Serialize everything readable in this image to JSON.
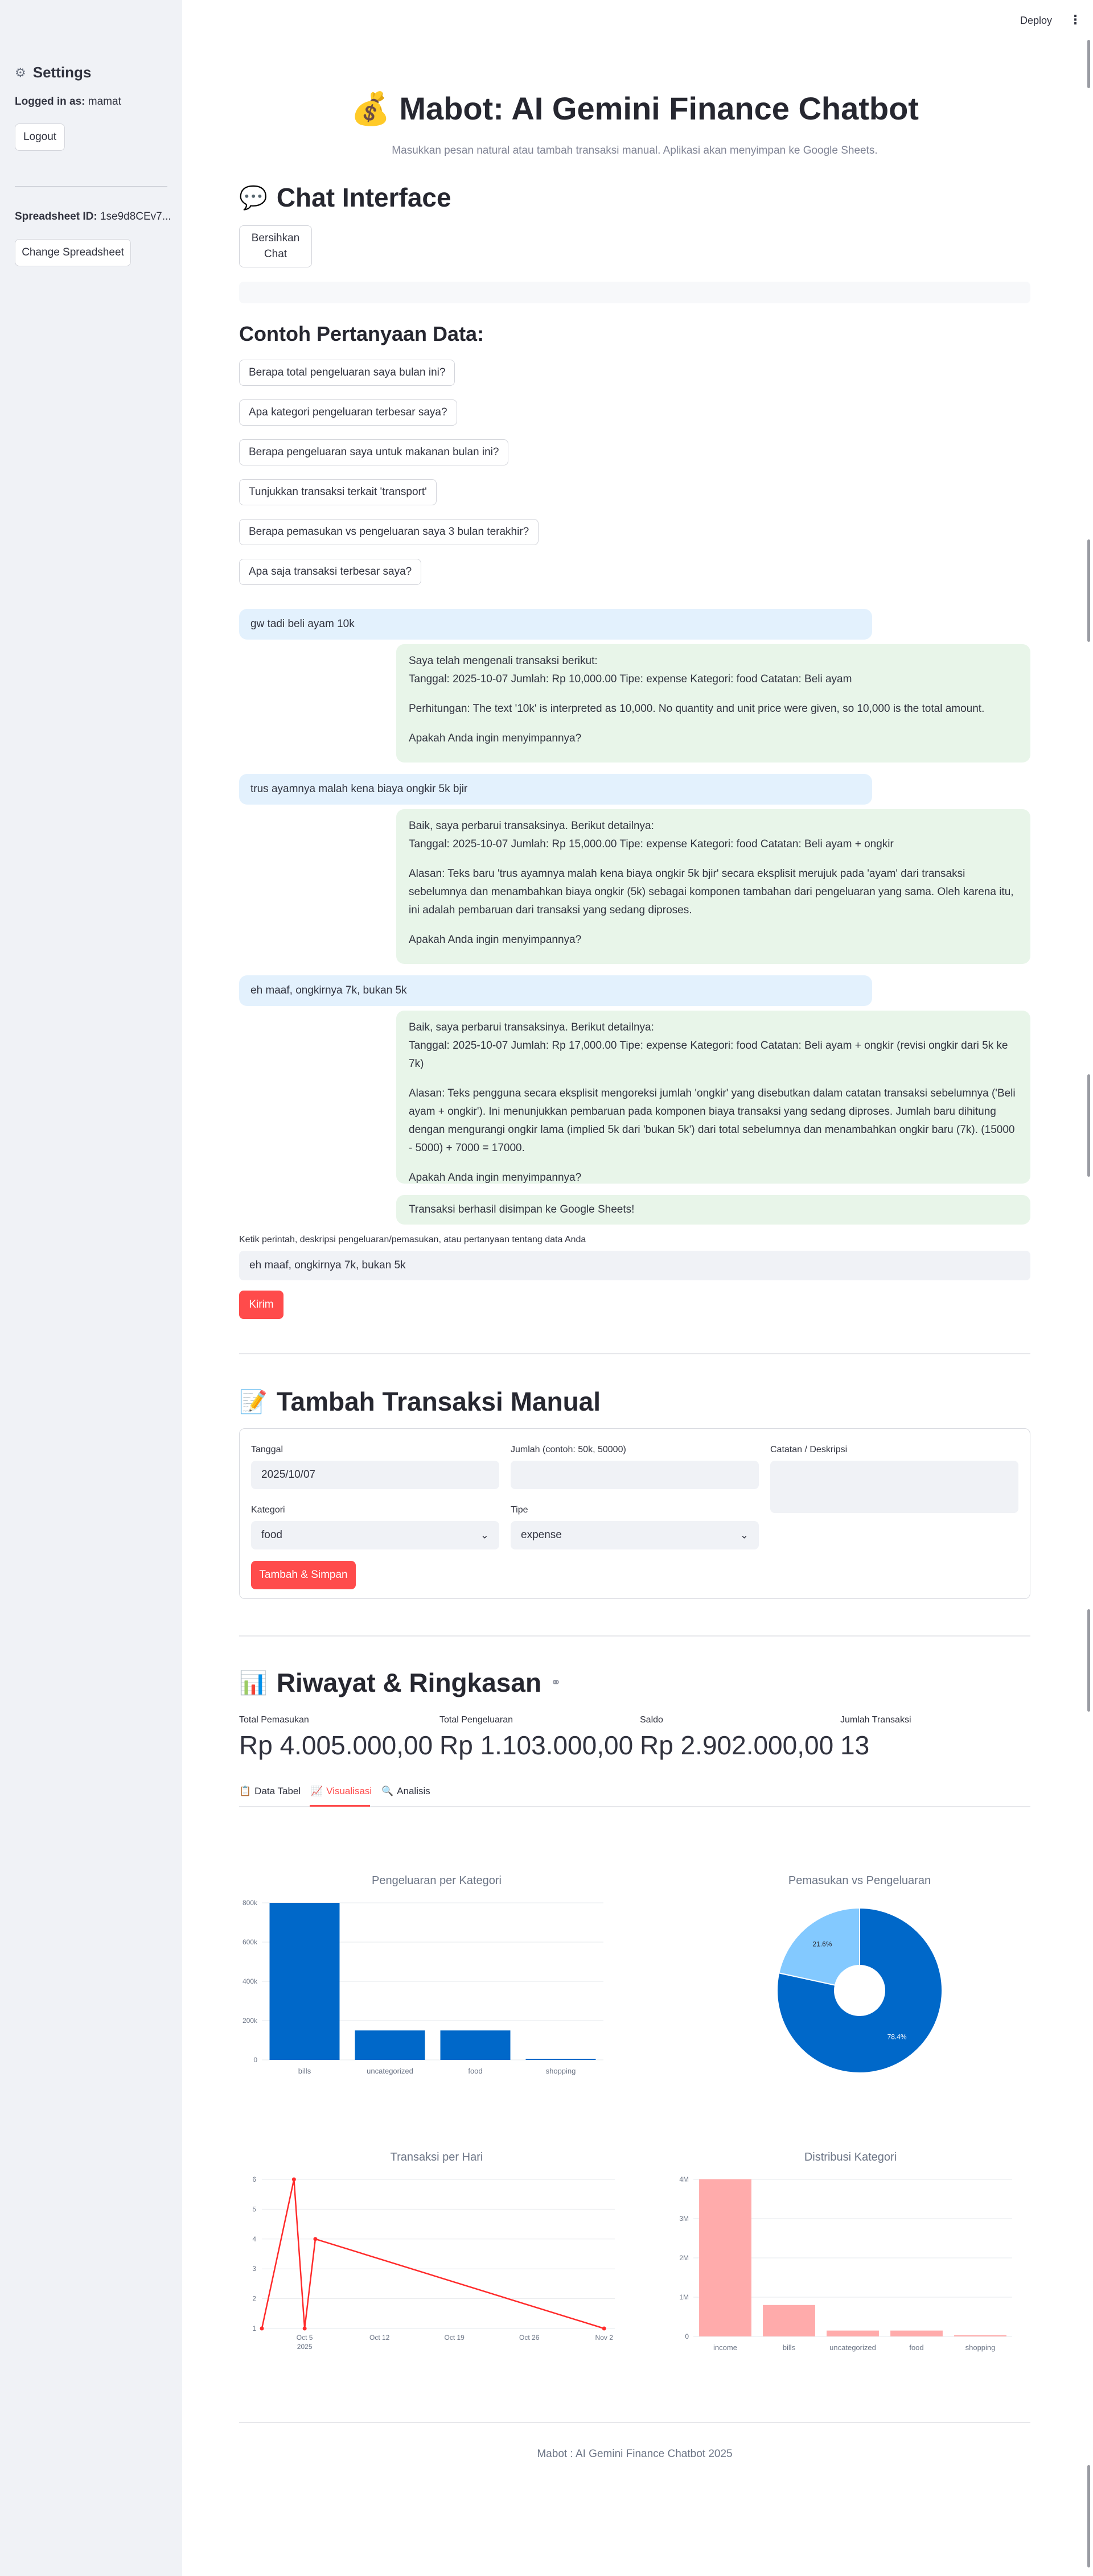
{
  "header": {
    "deploy": "Deploy",
    "menu": "⋮"
  },
  "sidebar": {
    "title": "Settings",
    "logged_in_label": "Logged in as:",
    "logged_in_user": "mamat",
    "logout": "Logout",
    "spreadsheet_label": "Spreadsheet ID:",
    "spreadsheet_id": "1se9d8CEv7...",
    "change_spreadsheet": "Change Spreadsheet"
  },
  "page": {
    "title": "Mabot: AI Gemini Finance Chatbot",
    "title_emoji": "💰",
    "subtitle": "Masukkan pesan natural atau tambah transaksi manual. Aplikasi akan menyimpan ke Google Sheets."
  },
  "chat": {
    "heading": "Chat Interface",
    "heading_emoji": "💬",
    "clear_button": "Bersihkan Chat",
    "examples_heading": "Contoh Pertanyaan Data:",
    "examples": [
      "Berapa total pengeluaran saya bulan ini?",
      "Apa kategori pengeluaran terbesar saya?",
      "Berapa pengeluaran saya untuk makanan bulan ini?",
      "Tunjukkan transaksi terkait 'transport'",
      "Berapa pemasukan vs pengeluaran saya 3 bulan terakhir?",
      "Apa saja transaksi terbesar saya?"
    ],
    "messages": [
      {
        "role": "user",
        "text": "gw tadi beli ayam 10k"
      },
      {
        "role": "bot",
        "lines": [
          "Saya telah mengenali transaksi berikut:\nTanggal: 2025-10-07 Jumlah: Rp 10,000.00 Tipe: expense Kategori: food Catatan: Beli ayam",
          "Perhitungan: The text '10k' is interpreted as 10,000. No quantity and unit price were given, so 10,000 is the total amount.",
          "Apakah Anda ingin menyimpannya?"
        ]
      },
      {
        "role": "user",
        "text": "trus ayamnya malah kena biaya ongkir 5k bjir"
      },
      {
        "role": "bot",
        "lines": [
          "Baik, saya perbarui transaksinya. Berikut detailnya:\nTanggal: 2025-10-07 Jumlah: Rp 15,000.00 Tipe: expense Kategori: food Catatan: Beli ayam + ongkir",
          "Alasan: Teks baru 'trus ayamnya malah kena biaya ongkir 5k bjir' secara eksplisit merujuk pada 'ayam' dari transaksi sebelumnya dan menambahkan biaya ongkir (5k) sebagai komponen tambahan dari pengeluaran yang sama. Oleh karena itu, ini adalah pembaruan dari transaksi yang sedang diproses.",
          "Apakah Anda ingin menyimpannya?"
        ]
      },
      {
        "role": "user",
        "text": "eh maaf, ongkirnya 7k, bukan 5k"
      },
      {
        "role": "bot",
        "lines": [
          "Baik, saya perbarui transaksinya. Berikut detailnya:\nTanggal: 2025-10-07 Jumlah: Rp 17,000.00 Tipe: expense Kategori: food Catatan: Beli ayam + ongkir (revisi ongkir dari 5k ke 7k)",
          "Alasan: Teks pengguna secara eksplisit mengoreksi jumlah 'ongkir' yang disebutkan dalam catatan transaksi sebelumnya ('Beli ayam + ongkir'). Ini menunjukkan pembaruan pada komponen biaya transaksi yang sedang diproses. Jumlah baru dihitung dengan mengurangi ongkir lama (implied 5k dari 'bukan 5k') dari total sebelumnya dan menambahkan ongkir baru (7k). (15000 - 5000) + 7000 = 17000.",
          "Apakah Anda ingin menyimpannya?"
        ]
      },
      {
        "role": "bot",
        "lines": [
          "Transaksi berhasil disimpan ke Google Sheets!"
        ]
      }
    ],
    "input_label": "Ketik perintah, deskripsi pengeluaran/pemasukan, atau pertanyaan tentang data Anda",
    "input_value": "eh maaf, ongkirnya 7k, bukan 5k",
    "send_button": "Kirim"
  },
  "manual": {
    "heading": "Tambah Transaksi Manual",
    "heading_emoji": "📝",
    "date_label": "Tanggal",
    "date_value": "2025/10/07",
    "amount_label": "Jumlah (contoh: 50k, 50000)",
    "amount_value": "",
    "note_label": "Catatan / Deskripsi",
    "note_value": "",
    "category_label": "Kategori",
    "category_value": "food",
    "type_label": "Tipe",
    "type_value": "expense",
    "submit": "Tambah & Simpan"
  },
  "history": {
    "heading": "Riwayat & Ringkasan",
    "heading_emoji": "📊",
    "link_icon": "link-icon",
    "metrics": [
      {
        "label": "Total Pemasukan",
        "value": "Rp 4.005.000,00"
      },
      {
        "label": "Total Pengeluaran",
        "value": "Rp 1.103.000,00"
      },
      {
        "label": "Saldo",
        "value": "Rp 2.902.000,00"
      },
      {
        "label": "Jumlah Transaksi",
        "value": "13"
      }
    ],
    "tabs": [
      {
        "label": "Data Tabel",
        "icon": "📋",
        "active": false
      },
      {
        "label": "Visualisasi",
        "icon": "📈",
        "active": true
      },
      {
        "label": "Analisis",
        "icon": "🔍",
        "active": false
      }
    ]
  },
  "colors": {
    "accent": "#ff4b4b",
    "blue": "#0068c9",
    "light_blue": "#83c9ff",
    "pink": "#ffabab",
    "user_bubble": "#e3f1fd",
    "bot_bubble": "#e8f5e9"
  },
  "chart_data": [
    {
      "type": "bar",
      "title": "Pengeluaran per Kategori",
      "categories": [
        "bills",
        "uncategorized",
        "food",
        "shopping"
      ],
      "values": [
        800000,
        150000,
        150000,
        3000
      ],
      "yticks": [
        "0",
        "200k",
        "400k",
        "600k",
        "800k"
      ],
      "ylim": [
        0,
        800000
      ]
    },
    {
      "type": "pie",
      "title": "Pemasukan vs Pengeluaran",
      "labels": [
        "Pemasukan",
        "Pengeluaran"
      ],
      "values": [
        78.4,
        21.6
      ],
      "slice_labels": [
        "78.4%",
        "21.6%"
      ]
    },
    {
      "type": "line",
      "title": "Transaksi per Hari",
      "x": [
        "2025-10-01",
        "2025-10-04",
        "2025-10-05",
        "2025-10-06",
        "2025-11-02"
      ],
      "values": [
        1,
        6,
        1,
        4,
        1
      ],
      "xticks": [
        "Oct 5\n2025",
        "Oct 12",
        "Oct 19",
        "Oct 26",
        "Nov 2"
      ],
      "yticks": [
        "1",
        "2",
        "3",
        "4",
        "5",
        "6"
      ]
    },
    {
      "type": "bar",
      "title": "Distribusi Kategori",
      "categories": [
        "income",
        "bills",
        "uncategorized",
        "food",
        "shopping"
      ],
      "values": [
        4005000,
        800000,
        150000,
        150000,
        3000
      ],
      "yticks": [
        "0",
        "1M",
        "2M",
        "3M",
        "4M"
      ],
      "ylim": [
        0,
        4000000
      ]
    }
  ],
  "footer": "Mabot : AI Gemini Finance Chatbot 2025"
}
